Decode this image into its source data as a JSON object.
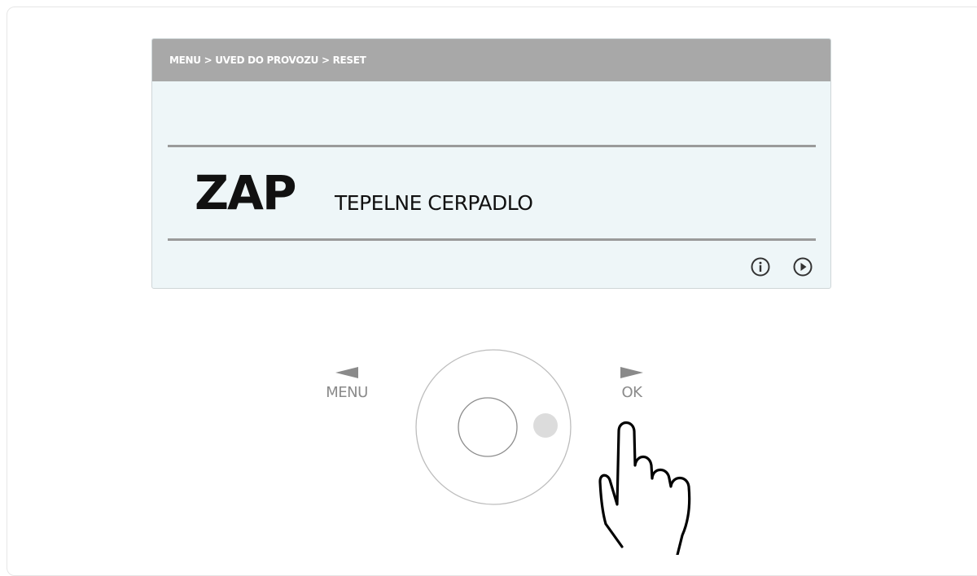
{
  "display": {
    "breadcrumb": "MENU > UVED DO PROVOZU > RESET",
    "value": "ZAP",
    "label": "TEPELNE CERPADLO",
    "icons": [
      "info-circle-icon",
      "play-circle-icon"
    ]
  },
  "controls": {
    "left_label": "MENU",
    "right_label": "OK",
    "icons": [
      "left-arrow-icon",
      "right-arrow-icon",
      "rotary-knob",
      "pointing-hand-icon"
    ]
  },
  "colors": {
    "header_bg": "#a8a8a8",
    "screen_bg": "#eef6f8",
    "text": "#111111",
    "control_gray": "#8a8a8a"
  }
}
